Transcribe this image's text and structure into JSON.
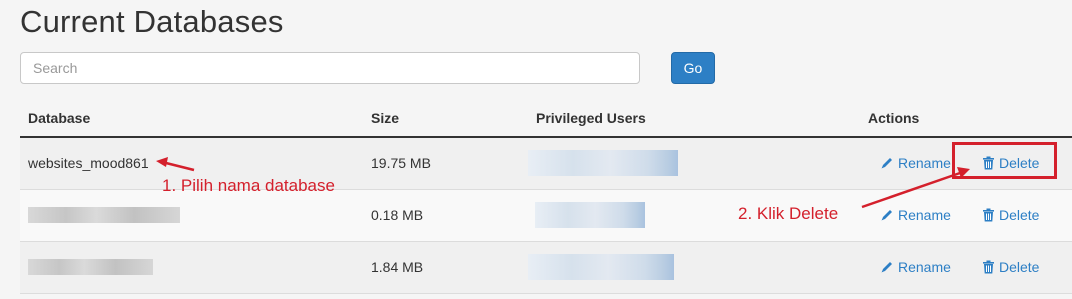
{
  "page_title": "Current Databases",
  "search": {
    "placeholder": "Search"
  },
  "go_label": "Go",
  "table": {
    "headers": {
      "database": "Database",
      "size": "Size",
      "users": "Privileged Users",
      "actions": "Actions"
    },
    "rows": [
      {
        "database": "websites_mood861",
        "size": "19.75 MB",
        "rename": "Rename",
        "delete": "Delete"
      },
      {
        "database": "",
        "size": "0.18 MB",
        "rename": "Rename",
        "delete": "Delete"
      },
      {
        "database": "",
        "size": "1.84 MB",
        "rename": "Rename",
        "delete": "Delete"
      }
    ]
  },
  "annotations": {
    "step1": "1. Pilih nama database",
    "step2": "2. Klik Delete"
  },
  "colors": {
    "accent": "#2d7fc5",
    "annotation": "#d4202c"
  }
}
